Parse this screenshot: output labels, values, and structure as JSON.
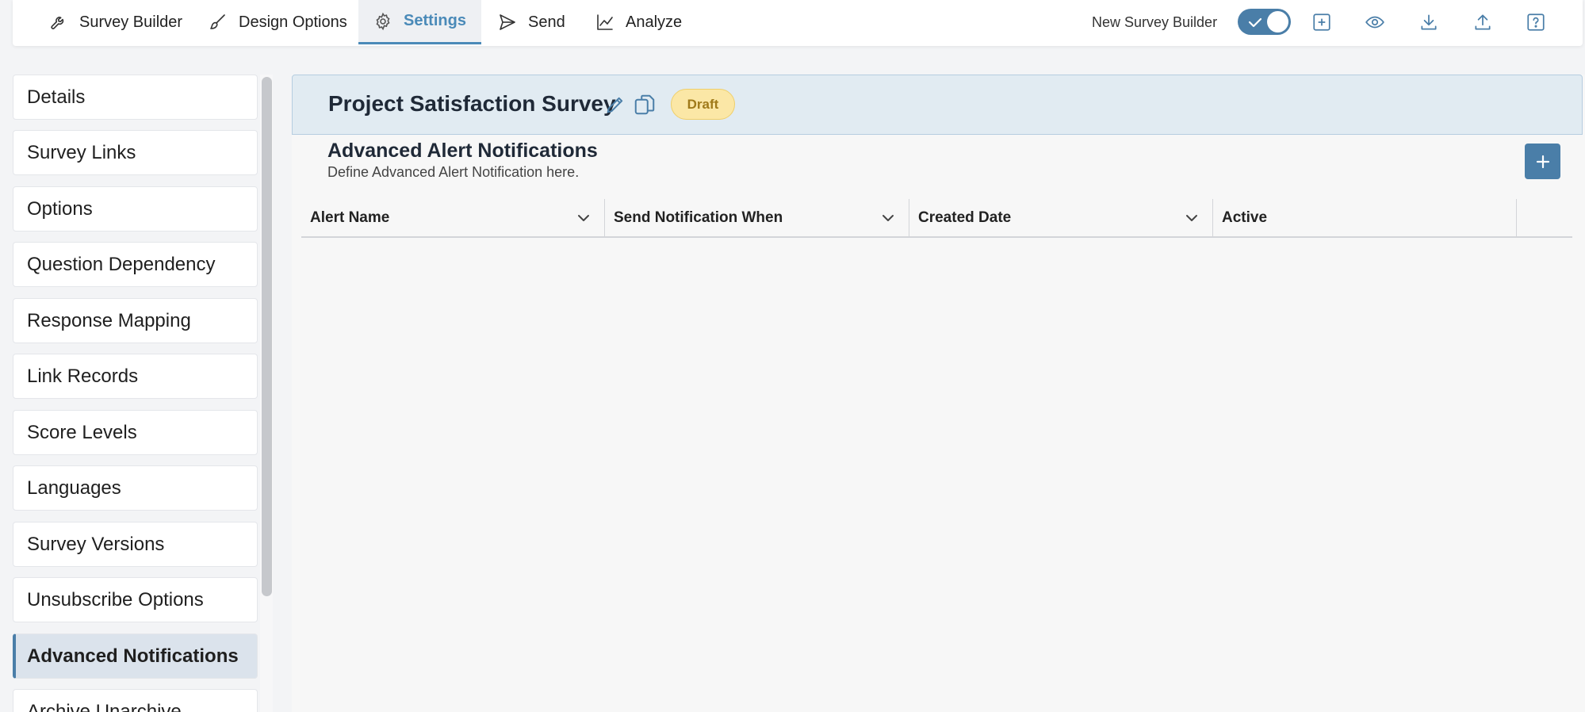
{
  "topnav": {
    "tabs": [
      {
        "label": "Survey Builder",
        "icon": "wrench-icon"
      },
      {
        "label": "Design Options",
        "icon": "brush-icon"
      },
      {
        "label": "Settings",
        "icon": "gear-icon"
      },
      {
        "label": "Send",
        "icon": "send-icon"
      },
      {
        "label": "Analyze",
        "icon": "chart-line-icon"
      }
    ],
    "active_tab": "Settings",
    "toggle_label": "New Survey Builder",
    "toggle_on": true,
    "tools": [
      "add-box-icon",
      "eye-icon",
      "download-icon",
      "upload-icon",
      "help-icon"
    ]
  },
  "sidebar": {
    "items": [
      {
        "label": "Details"
      },
      {
        "label": "Survey Links"
      },
      {
        "label": "Options"
      },
      {
        "label": "Question Dependency"
      },
      {
        "label": "Response Mapping"
      },
      {
        "label": "Link Records"
      },
      {
        "label": "Score Levels"
      },
      {
        "label": "Languages"
      },
      {
        "label": "Survey Versions"
      },
      {
        "label": "Unsubscribe Options"
      },
      {
        "label": "Advanced Notifications"
      },
      {
        "label": "Archive Unarchive"
      }
    ],
    "active_item": "Advanced Notifications"
  },
  "main": {
    "survey_title": "Project Satisfaction Survey",
    "status_badge": "Draft",
    "section_title": "Advanced Alert Notifications",
    "section_subtitle": "Define Advanced Alert Notification here.",
    "table": {
      "columns": [
        {
          "label": "Alert Name",
          "sortable": true
        },
        {
          "label": "Send Notification When",
          "sortable": true
        },
        {
          "label": "Created Date",
          "sortable": true
        },
        {
          "label": "Active",
          "sortable": false
        }
      ],
      "rows": []
    }
  },
  "colors": {
    "accent": "#4a7ea8",
    "active_tab_text": "#4a8ab8",
    "badge_bg": "#fbe7a6",
    "header_bg": "#e1ebf2"
  }
}
